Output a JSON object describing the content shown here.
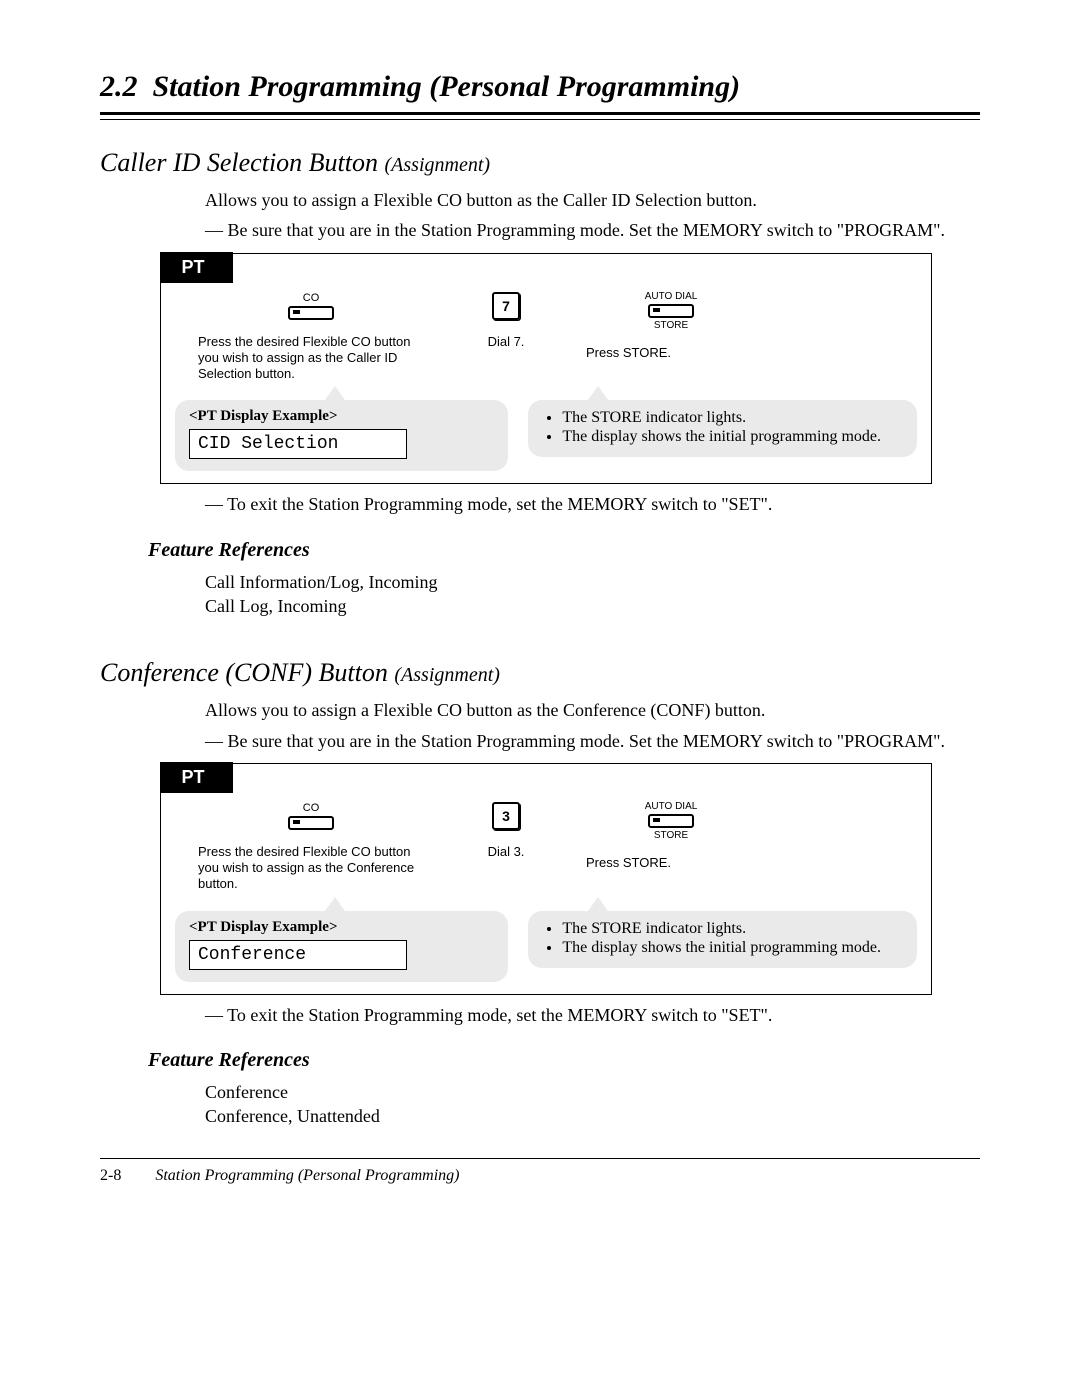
{
  "header": {
    "section_number": "2.2",
    "section_title": "Station Programming (Personal Programming)"
  },
  "sections": [
    {
      "title_main": "Caller ID Selection Button",
      "title_sub": "(Assignment)",
      "intro": "Allows you to assign a Flexible CO button as the Caller ID Selection button.",
      "precondition": "— Be sure that you are in the Station Programming mode. Set the MEMORY switch to \"PROGRAM\".",
      "pt": {
        "tab": "PT",
        "co_label": "CO",
        "co_caption": "Press the desired Flexible CO button you wish to assign as the Caller ID Selection button.",
        "dial_key": "7",
        "dial_caption": "Dial 7.",
        "auto_dial_label": "AUTO DIAL",
        "store_label": "STORE",
        "store_caption": "Press STORE.",
        "display_title": "<PT Display Example>",
        "display_text": "CID Selection",
        "notes": [
          "The STORE indicator lights.",
          "The display shows the initial programming mode."
        ]
      },
      "exit_note": "— To exit the Station Programming mode, set the MEMORY switch to \"SET\".",
      "feature_heading": "Feature References",
      "references": [
        "Call Information/Log, Incoming",
        "Call Log, Incoming"
      ]
    },
    {
      "title_main": "Conference (CONF) Button",
      "title_sub": "(Assignment)",
      "intro": "Allows you to assign a Flexible CO button as the Conference (CONF) button.",
      "precondition": "— Be sure that you are in the Station Programming mode. Set the MEMORY switch to \"PROGRAM\".",
      "pt": {
        "tab": "PT",
        "co_label": "CO",
        "co_caption": "Press the desired Flexible CO button you wish to assign as the Conference button.",
        "dial_key": "3",
        "dial_caption": "Dial 3.",
        "auto_dial_label": "AUTO DIAL",
        "store_label": "STORE",
        "store_caption": "Press STORE.",
        "display_title": "<PT Display Example>",
        "display_text": "Conference",
        "notes": [
          "The STORE indicator lights.",
          "The display shows the initial programming mode."
        ]
      },
      "exit_note": "— To exit the Station Programming mode, set the MEMORY switch to \"SET\".",
      "feature_heading": "Feature References",
      "references": [
        "Conference",
        "Conference, Unattended"
      ]
    }
  ],
  "footer": {
    "page_number": "2-8",
    "title": "Station Programming (Personal Programming)"
  }
}
